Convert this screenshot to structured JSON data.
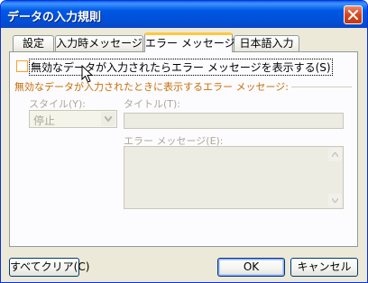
{
  "window": {
    "title": "データの入力規則"
  },
  "tabs": [
    {
      "label": "設定"
    },
    {
      "label": "入力時メッセージ"
    },
    {
      "label": "エラー メッセージ"
    },
    {
      "label": "日本語入力"
    }
  ],
  "error_tab": {
    "show_error_checkbox": {
      "label": "無効なデータが入力されたらエラー メッセージを表示する(S)",
      "checked": false
    },
    "group_label": "無効なデータが入力されたときに表示するエラー メッセージ:",
    "style_label": "スタイル(Y):",
    "style_value": "停止",
    "title_label": "タイトル(T):",
    "title_value": "",
    "message_label": "エラー メッセージ(E):",
    "message_value": ""
  },
  "buttons": {
    "clear_all": "すべてクリア(C)",
    "ok": "OK",
    "cancel": "キャンセル"
  },
  "colors": {
    "titlebar": "#0058e6",
    "dialog_bg": "#ece9d8",
    "group_label": "#c86f0a",
    "active_tab_accent": "#ffc83c"
  },
  "icons": [
    "close-icon",
    "dropdown-arrow-icon",
    "scroll-up-icon",
    "scroll-down-icon",
    "mouse-cursor-icon"
  ]
}
